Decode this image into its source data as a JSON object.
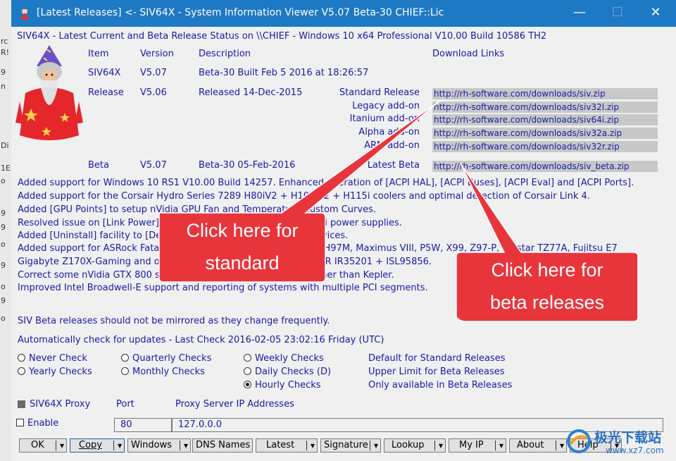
{
  "window": {
    "title": "[Latest Releases] <- SIV64X - System Information Viewer V5.07 Beta-30 CHIEF::Lic",
    "minimize": "—",
    "maximize": "☐",
    "close": "✕"
  },
  "heading": "SIV64X - Latest Current and Beta Release Status on \\\\CHIEF - Windows 10 x64 Professional  V10.00  Build 10586  TH2",
  "columns": {
    "item": "Item",
    "version": "Version",
    "description": "Description",
    "download": "Download Links"
  },
  "rows": {
    "siv": {
      "item": "SIV64X",
      "version": "V5.07",
      "description": "Beta-30  Built Feb  5 2016 at 18:26:57"
    },
    "release": {
      "item": "Release",
      "version": "V5.06",
      "description": "Released 14-Dec-2015"
    },
    "beta": {
      "item": "Beta",
      "version": "V5.07",
      "description": "Beta-30 05-Feb-2016"
    }
  },
  "links": [
    {
      "label": "Standard Release",
      "url": "http://rh-software.com/downloads/siv.zip"
    },
    {
      "label": "Legacy add-on",
      "url": "http://rh-software.com/downloads/siv32l.zip"
    },
    {
      "label": "Itanium add-on",
      "url": "http://rh-software.com/downloads/siv64i.zip"
    },
    {
      "label": "Alpha add-on",
      "url": "http://rh-software.com/downloads/siv32a.zip"
    },
    {
      "label": "ARM add-on",
      "url": "http://rh-software.com/downloads/siv32r.zip"
    }
  ],
  "beta_link": {
    "label": "Latest Beta",
    "url": "http://rh-software.com/downloads/siv_beta.zip"
  },
  "notes": [
    "Added support for Windows 10 RS1 V10.00 Build 14257. Enhanced operation of [ACPI HAL], [ACPI Buses], [ACPI Eval] and [ACPI Ports].",
    "Added support for the Corsair Hydro Series 7289 H80iV2 + H100iV2 + H115i coolers and optimal detection of Corsair Link 4.",
    "Added [GPU Points] to setup nVidia GPU Fan and Temperature Custom Curves.",
    "Resolved issue on [Link Power] with systems that have multiple AXi power supplies.",
    "Added [Uninstall] facility to [Device Manager] to remove Ghost Devices.",
    "Added support for ASRock Fatal1ty, ASUS Maximus VIII Formula-Z, H97M, Maximus VIII, P5W, X99, Z97-P, Biostar TZ77A, Fujitsu E7",
    "Gigabyte Z170X-Gaming and other new motherboards including IOR IR35201 + ISL95856.",
    "Correct some nVidia GTX 800 series GPUs to report as Maxwell rather than Kepler.",
    "Improved Intel Broadwell-E support and reporting of systems with multiple PCI segments."
  ],
  "mirror_note": "SIV Beta releases should not be mirrored as they change frequently.",
  "auto_check": "Automatically check for updates - Last Check 2016-02-05 23:02:16 Friday (UTC)",
  "radios": {
    "never": "Never Check",
    "yearly": "Yearly Checks",
    "quarterly": "Quarterly Checks",
    "monthly": "Monthly Checks",
    "weekly": "Weekly Checks",
    "daily": "Daily Checks (D)",
    "hourly": "Hourly Checks",
    "selected": "hourly"
  },
  "radio_notes": [
    "Default for Standard Releases",
    "Upper Limit for Beta Releases",
    "Only available in Beta Releases"
  ],
  "proxy": {
    "title": "SIV64X Proxy",
    "port_label": "Port",
    "ips_label": "Proxy Server IP Addresses",
    "enable": "Enable",
    "port": "80",
    "ip": "127.0.0.0"
  },
  "buttons": [
    "OK",
    "Copy",
    "Windows",
    "DNS Names",
    "Latest",
    "Signature",
    "Lookup",
    "My IP",
    "About",
    "Help"
  ],
  "callouts": {
    "standard": [
      "Click here for",
      "standard"
    ],
    "beta": [
      "Click here for",
      "beta releases"
    ]
  },
  "watermark": {
    "text": "极光下载站",
    "url": "www.xz7.com"
  },
  "colors": {
    "titlebar": "#1e79c4",
    "text": "#1a1aa6",
    "callout": "#e8353b",
    "url_bg": "#c8c8c8"
  }
}
